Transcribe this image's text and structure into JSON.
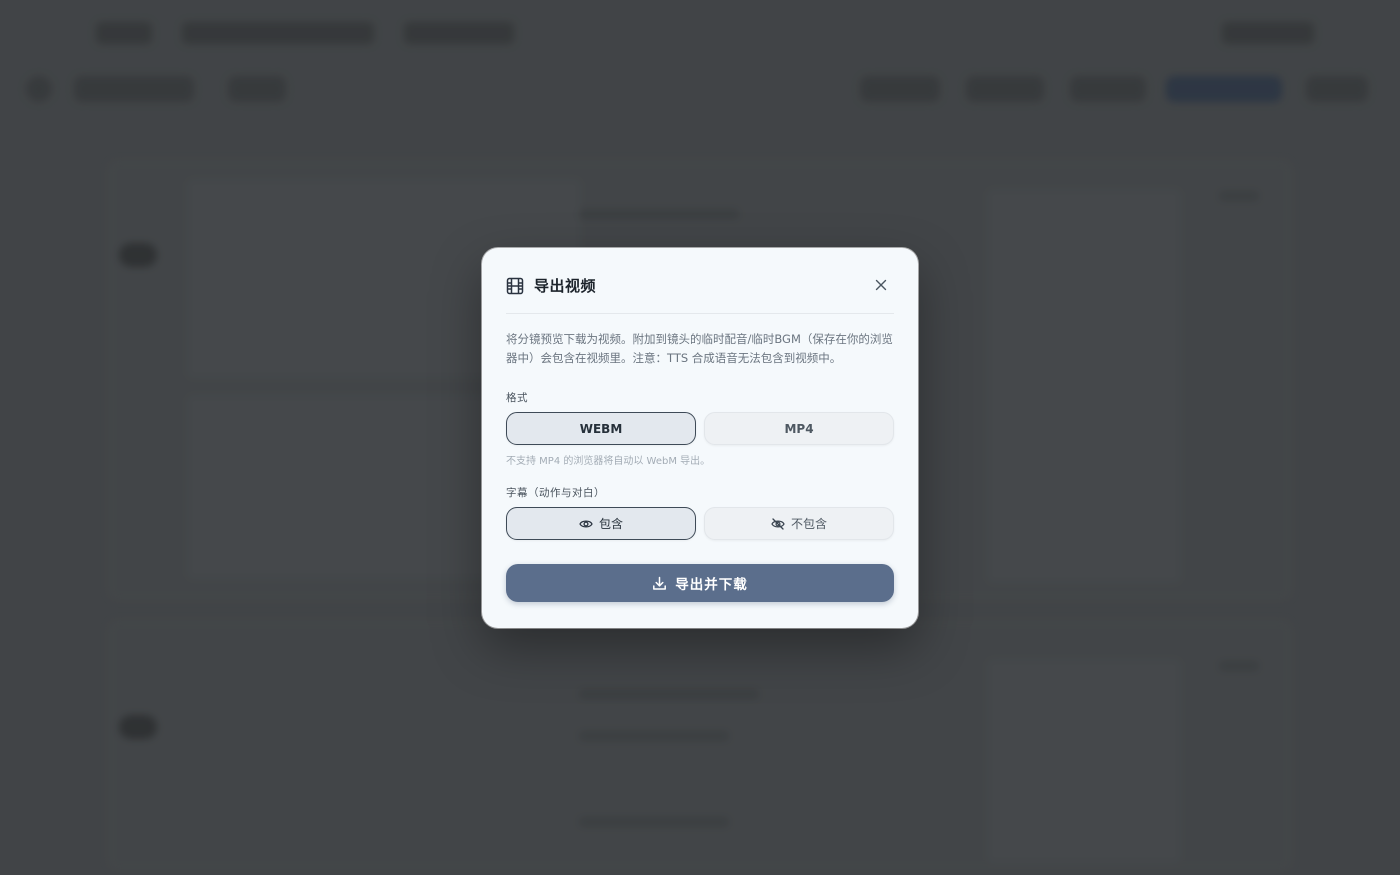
{
  "dialog": {
    "title": "导出视频",
    "description": "将分镜预览下载为视频。附加到镜头的临时配音/临时BGM（保存在你的浏览器中）会包含在视频里。注意：TTS 合成语音无法包含到视频中。",
    "format": {
      "label": "格式",
      "options": [
        "WEBM",
        "MP4"
      ],
      "selected": "WEBM",
      "hint": "不支持 MP4 的浏览器将自动以 WebM 导出。"
    },
    "subtitles": {
      "label": "字幕（动作与对白）",
      "options": [
        {
          "label": "包含",
          "icon": "eye-icon"
        },
        {
          "label": "不包含",
          "icon": "eye-off-icon"
        }
      ],
      "selected": "包含"
    },
    "export_button": {
      "label": "导出并下载",
      "icon": "download-icon"
    },
    "icons": {
      "title": "film-icon",
      "close": "close-icon"
    }
  },
  "colors": {
    "primary_button": "#5b6e8c",
    "selected_border": "#3e4a57",
    "overlay": "#4a4d50",
    "dialog_bg": "#f5f9fc"
  }
}
